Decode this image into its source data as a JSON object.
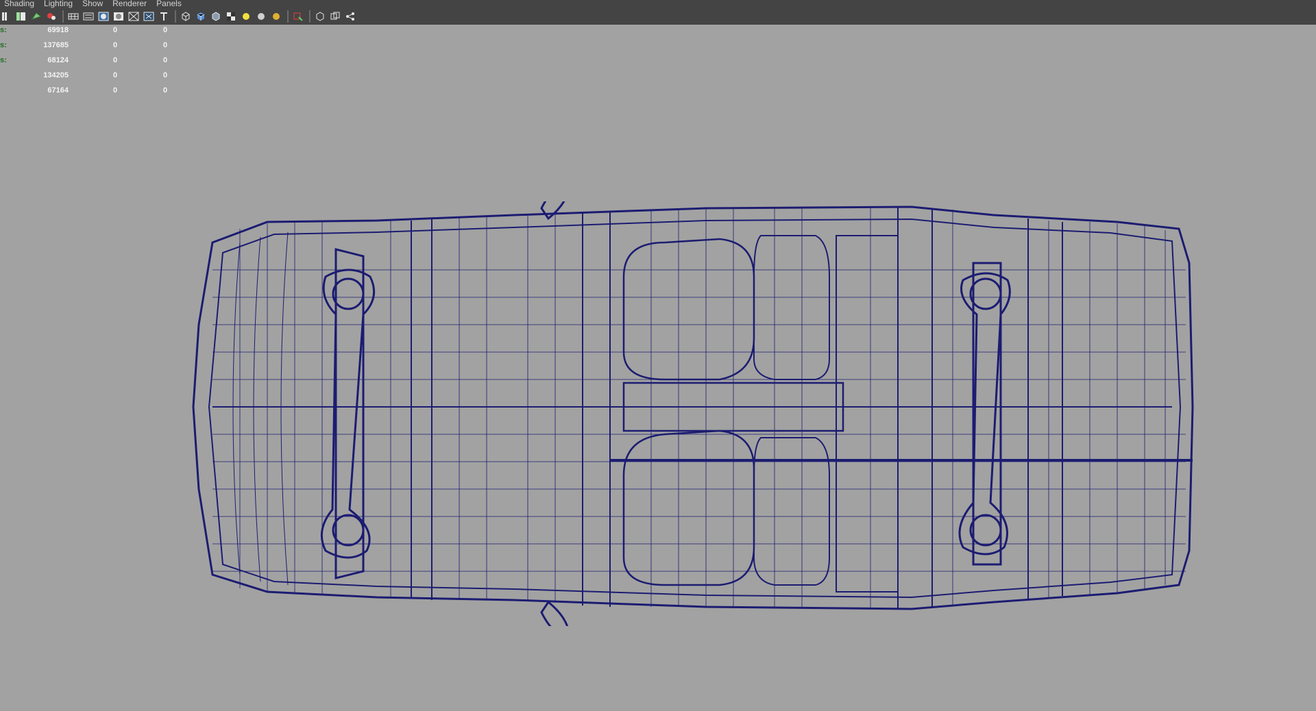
{
  "menu": [
    "Shading",
    "Lighting",
    "Show",
    "Renderer",
    "Panels"
  ],
  "toolbar": {
    "icons": [
      "camera-icon",
      "bookmark-icon",
      "image-plane-icon",
      "grid-icon",
      "sep",
      "wireframe-icon",
      "film-gate-icon",
      "resolution-gate-icon",
      "safe-title-icon",
      "field-chart-icon",
      "xray-icon",
      "text-icon",
      "sep",
      "wireframe-cube-icon",
      "smooth-shade-icon",
      "flat-shade-icon",
      "checker-icon",
      "default-light-icon",
      "all-lights-icon",
      "ambient-occlusion-icon",
      "sep",
      "isolate-select-icon",
      "sep",
      "wire-on-shaded-icon",
      "xray-joints-icon",
      "share-icon"
    ]
  },
  "hud": {
    "rows": [
      {
        "label": "s:",
        "v1": "69918",
        "v2": "0",
        "v3": "0"
      },
      {
        "label": "s:",
        "v1": "137685",
        "v2": "0",
        "v3": "0"
      },
      {
        "label": "s:",
        "v1": "68124",
        "v2": "0",
        "v3": "0"
      },
      {
        "label": "",
        "v1": "134205",
        "v2": "0",
        "v3": "0"
      },
      {
        "label": "",
        "v1": "67164",
        "v2": "0",
        "v3": "0"
      }
    ]
  },
  "colors": {
    "viewport_bg": "#a2a2a2",
    "wireframe": "#1c1c72",
    "hud_text": "#f2f2f2",
    "hud_label": "#1f6b22"
  }
}
